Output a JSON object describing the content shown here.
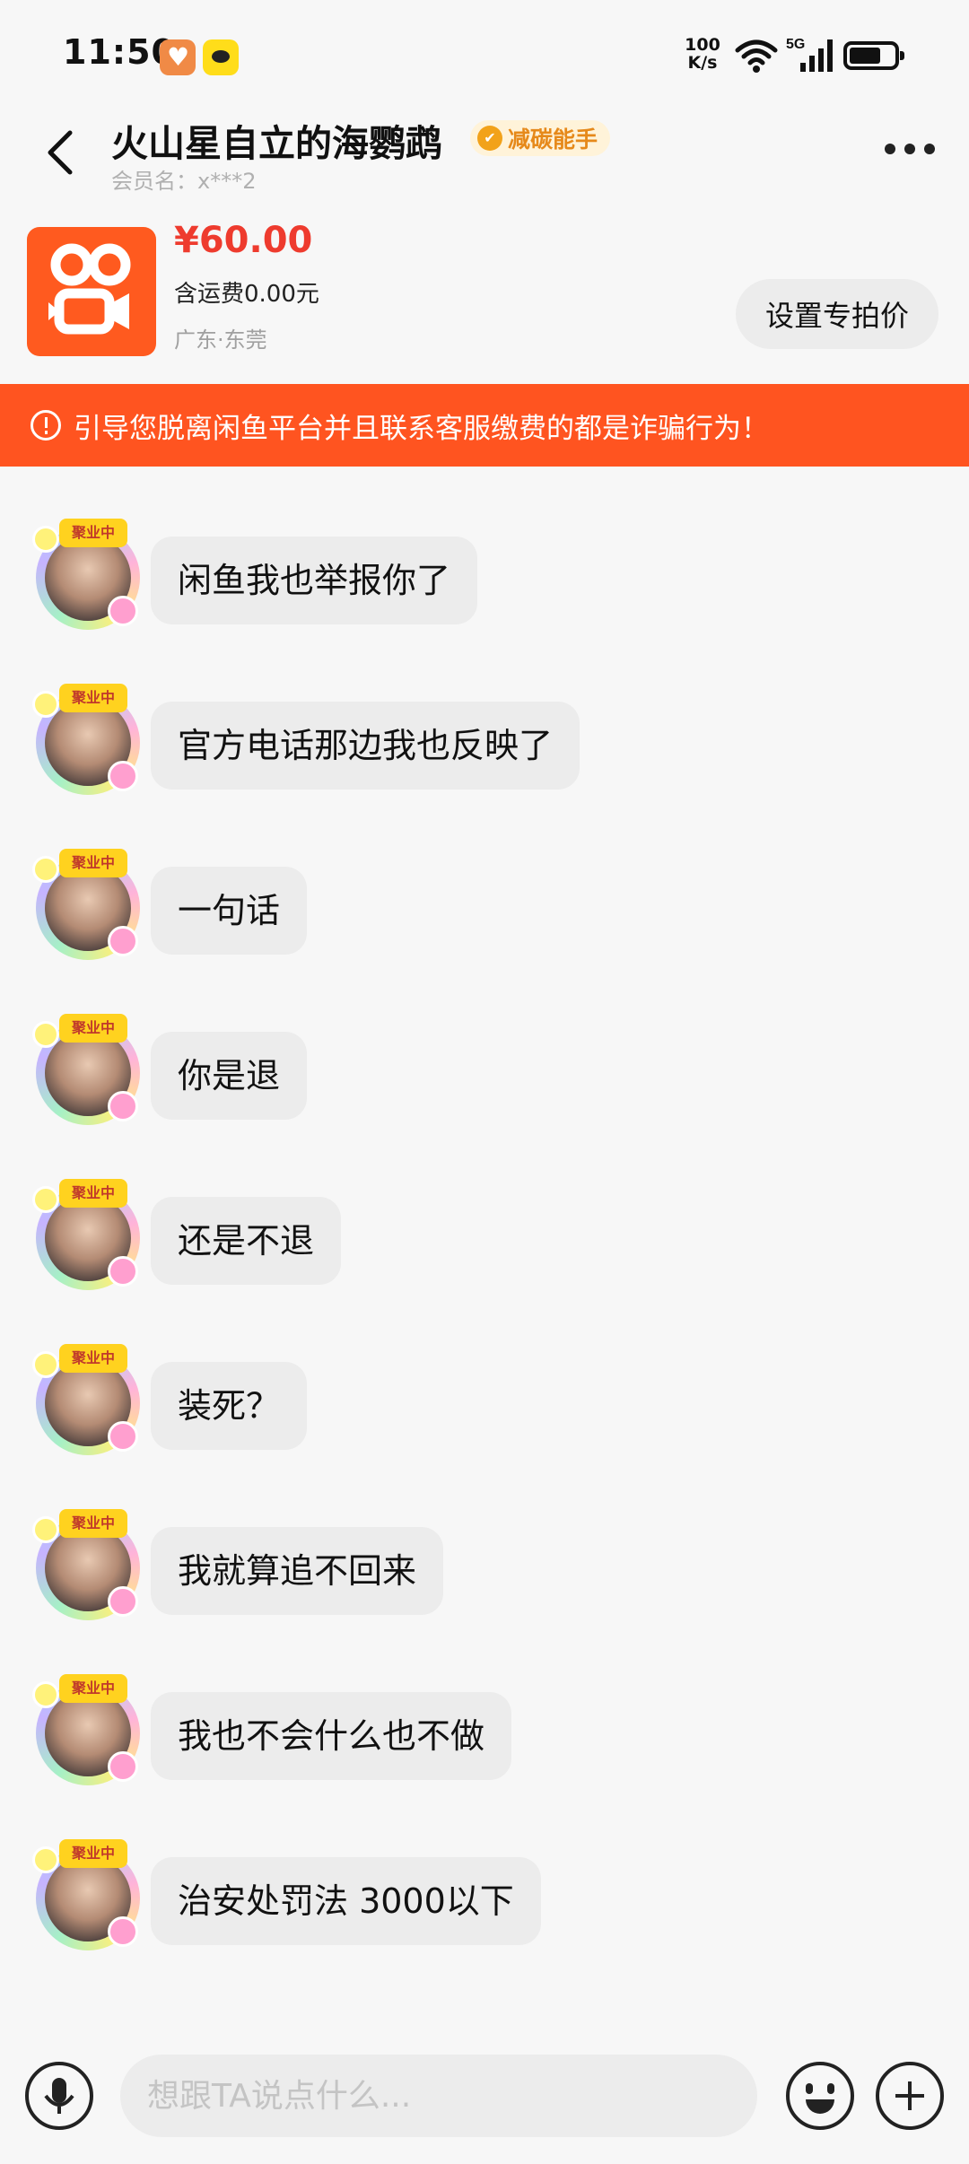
{
  "status_bar": {
    "time": "11:50",
    "net_speed_value": "100",
    "net_speed_unit": "K/s",
    "network": "5G",
    "icons": [
      "heart-app-icon",
      "yellow-app-icon",
      "wifi-icon",
      "signal-icon",
      "battery-icon"
    ]
  },
  "header": {
    "title": "火山星自立的海鹦鹉",
    "badge": "减碳能手",
    "member_name": "会员名：x***2",
    "icons": [
      "back-icon",
      "more-icon"
    ]
  },
  "product": {
    "price": "¥60.00",
    "shipping": "含运费0.00元",
    "location": "广东·东莞",
    "special_price_button": "设置专拍价",
    "thumb_caption": "快手",
    "thumb_color": "#ff5a1f"
  },
  "warning": {
    "text": "引导您脱离闲鱼平台并且联系客服缴费的都是诈骗行为！",
    "color": "#ff5420"
  },
  "messages": [
    {
      "text": "闲鱼我也举报你了",
      "avatar_tag": "聚业中"
    },
    {
      "text": "官方电话那边我也反映了",
      "avatar_tag": "聚业中"
    },
    {
      "text": "一句话",
      "avatar_tag": "聚业中"
    },
    {
      "text": "你是退",
      "avatar_tag": "聚业中"
    },
    {
      "text": "还是不退",
      "avatar_tag": "聚业中"
    },
    {
      "text": "装死？",
      "avatar_tag": "聚业中"
    },
    {
      "text": "我就算追不回来",
      "avatar_tag": "聚业中"
    },
    {
      "text": "我也不会什么也不做",
      "avatar_tag": "聚业中"
    },
    {
      "text": "治安处罚法 3000以下",
      "avatar_tag": "聚业中"
    }
  ],
  "input_bar": {
    "placeholder": "想跟TA说点什么...",
    "icons": [
      "microphone-icon",
      "emoji-icon",
      "plus-icon"
    ]
  }
}
